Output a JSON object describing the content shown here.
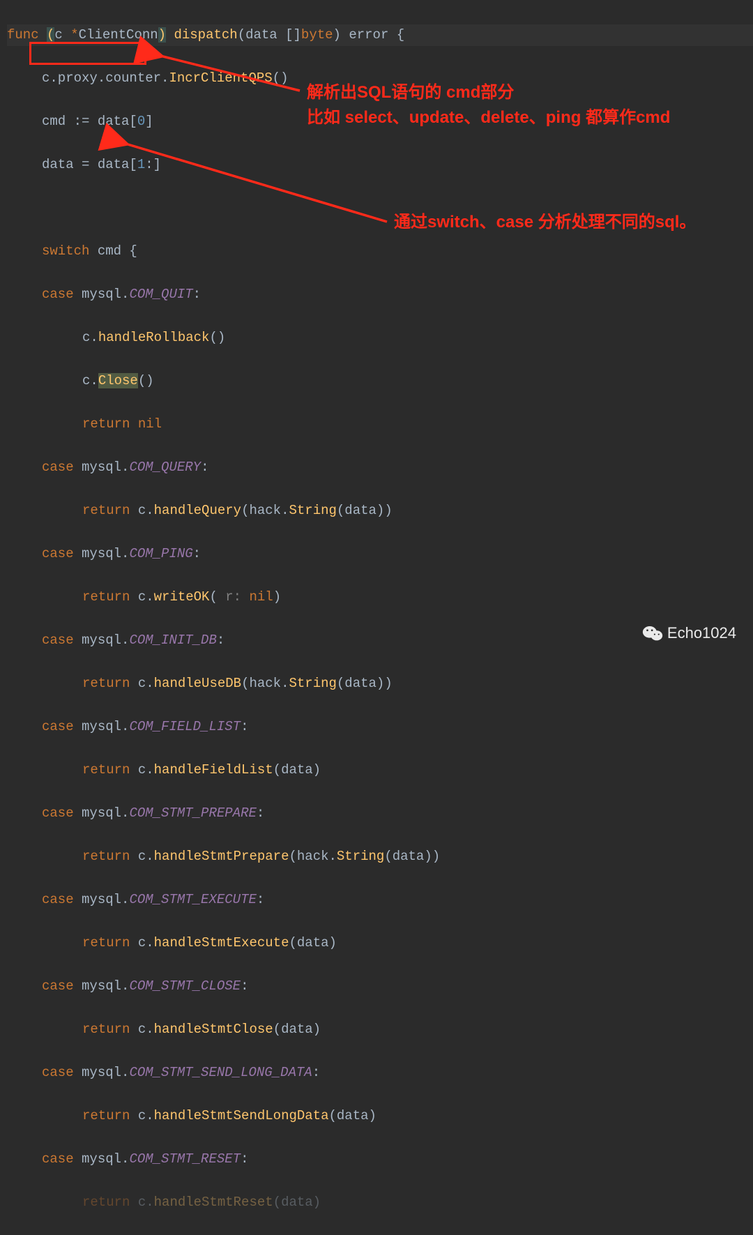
{
  "code": {
    "l1": {
      "func": "func",
      "lp": "(",
      "recv": "c ",
      "star": "*",
      "type": "ClientConn",
      "rp": ")",
      "name": " dispatch",
      "params": "(data []",
      "byte": "byte",
      "rp2": ")",
      "ret": " error ",
      "brace": "{"
    },
    "l2": {
      "a": "c.proxy.counter.",
      "fn": "IncrClientQPS",
      "b": "()"
    },
    "l3": {
      "a": "cmd := data[",
      "n": "0",
      "b": "]"
    },
    "l4": {
      "a": "data = data[",
      "n": "1",
      "b": ":]"
    },
    "l5": "",
    "l6": {
      "sw": "switch",
      "a": " cmd {"
    },
    "l7": {
      "cs": "case",
      "a": " mysql.",
      "cnst": "COM_QUIT",
      "b": ":"
    },
    "l8": {
      "a": "c.",
      "fn": "handleRollback",
      "b": "()"
    },
    "l9": {
      "a": "c.",
      "fn": "Close",
      "b": "()"
    },
    "l10": {
      "ret": "return",
      "nil": " nil"
    },
    "l11": {
      "cs": "case",
      "a": " mysql.",
      "cnst": "COM_QUERY",
      "b": ":"
    },
    "l12": {
      "ret": "return",
      "a": " c.",
      "fn": "handleQuery",
      "b": "(hack.",
      "fn2": "String",
      "c": "(data))"
    },
    "l13": {
      "cs": "case",
      "a": " mysql.",
      "cnst": "COM_PING",
      "b": ":"
    },
    "l14": {
      "ret": "return",
      "a": " c.",
      "fn": "writeOK",
      "b": "( ",
      "hint": "r:",
      "nil": " nil",
      "c": ")"
    },
    "l15": {
      "cs": "case",
      "a": " mysql.",
      "cnst": "COM_INIT_DB",
      "b": ":"
    },
    "l16": {
      "ret": "return",
      "a": " c.",
      "fn": "handleUseDB",
      "b": "(hack.",
      "fn2": "String",
      "c": "(data))"
    },
    "l17": {
      "cs": "case",
      "a": " mysql.",
      "cnst": "COM_FIELD_LIST",
      "b": ":"
    },
    "l18": {
      "ret": "return",
      "a": " c.",
      "fn": "handleFieldList",
      "b": "(data)"
    },
    "l19": {
      "cs": "case",
      "a": " mysql.",
      "cnst": "COM_STMT_PREPARE",
      "b": ":"
    },
    "l20": {
      "ret": "return",
      "a": " c.",
      "fn": "handleStmtPrepare",
      "b": "(hack.",
      "fn2": "String",
      "c": "(data))"
    },
    "l21": {
      "cs": "case",
      "a": " mysql.",
      "cnst": "COM_STMT_EXECUTE",
      "b": ":"
    },
    "l22": {
      "ret": "return",
      "a": " c.",
      "fn": "handleStmtExecute",
      "b": "(data)"
    },
    "l23": {
      "cs": "case",
      "a": " mysql.",
      "cnst": "COM_STMT_CLOSE",
      "b": ":"
    },
    "l24": {
      "ret": "return",
      "a": " c.",
      "fn": "handleStmtClose",
      "b": "(data)"
    },
    "l25": {
      "cs": "case",
      "a": " mysql.",
      "cnst": "COM_STMT_SEND_LONG_DATA",
      "b": ":"
    },
    "l26": {
      "ret": "return",
      "a": " c.",
      "fn": "handleStmtSendLongData",
      "b": "(data)"
    },
    "l27": {
      "cs": "case",
      "a": " mysql.",
      "cnst": "COM_STMT_RESET",
      "b": ":"
    },
    "l28": {
      "ret": "return",
      "a": " c.",
      "fn": "handleStmtReset",
      "b": "(data)"
    }
  },
  "annot": {
    "a1_l1": "解析出SQL语句的 cmd部分",
    "a1_l2": "比如 select、update、delete、ping 都算作cmd",
    "a2": "通过switch、case 分析处理不同的sql。"
  },
  "watermark": "Echo1024"
}
